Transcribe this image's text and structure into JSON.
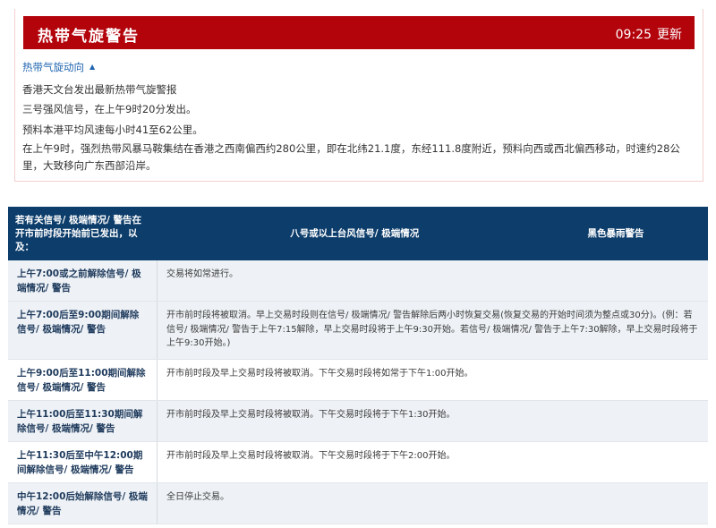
{
  "warning": {
    "title": "热带气旋警告",
    "time": "09:25",
    "update_label": "更新",
    "track_link": "热带气旋动向",
    "lines": [
      "香港天文台发出最新热带气旋警报",
      "三号强风信号，在上午9时20分发出。",
      "预料本港平均风速每小时41至62公里。",
      "在上午9时，强烈热带风暴马鞍集结在香港之西南偏西约280公里，即在北纬21.1度，东经111.8度附近，预料向西或西北偏西移动，时速约28公里，大致移向广东西部沿岸。"
    ]
  },
  "table": {
    "headers": [
      "若有关信号/ 极端情况/ 警告在开市前时段开始前已发出，以及：",
      "八号或以上台风信号/ 极端情况",
      "黑色暴雨警告"
    ],
    "rows": [
      {
        "condition": "上午7:00或之前解除信号/ 极端情况/ 警告",
        "description": "交易将如常进行。"
      },
      {
        "condition": "上午7:00后至9:00期间解除信号/ 极端情况/ 警告",
        "description": "开市前时段将被取消。早上交易时段则在信号/ 极端情况/ 警告解除后两小时恢复交易(恢复交易的开始时间须为整点或30分)。(例：若信号/ 极端情况/ 警告于上午7:15解除，早上交易时段将于上午9:30开始。若信号/ 极端情况/ 警告于上午7:30解除，早上交易时段将于上午9:30开始。)"
      },
      {
        "condition": "上午9:00后至11:00期间解除信号/ 极端情况/ 警告",
        "description": "开市前时段及早上交易时段将被取消。下午交易时段将如常于下午1:00开始。"
      },
      {
        "condition": "上午11:00后至11:30期间解除信号/ 极端情况/ 警告",
        "description": "开市前时段及早上交易时段将被取消。下午交易时段将于下午1:30开始。"
      },
      {
        "condition": "上午11:30后至中午12:00期间解除信号/ 极端情况/ 警告",
        "description": "开市前时段及早上交易时段将被取消。下午交易时段将于下午2:00开始。"
      },
      {
        "condition": "中午12:00后始解除信号/ 极端情况/ 警告",
        "description": "全日停止交易。"
      }
    ]
  },
  "colors": {
    "header_red": "#b3030b",
    "table_header_blue": "#0d3d6b",
    "link_blue": "#1f64b0"
  },
  "icons": {
    "track_toggle": "caret-up-icon"
  }
}
